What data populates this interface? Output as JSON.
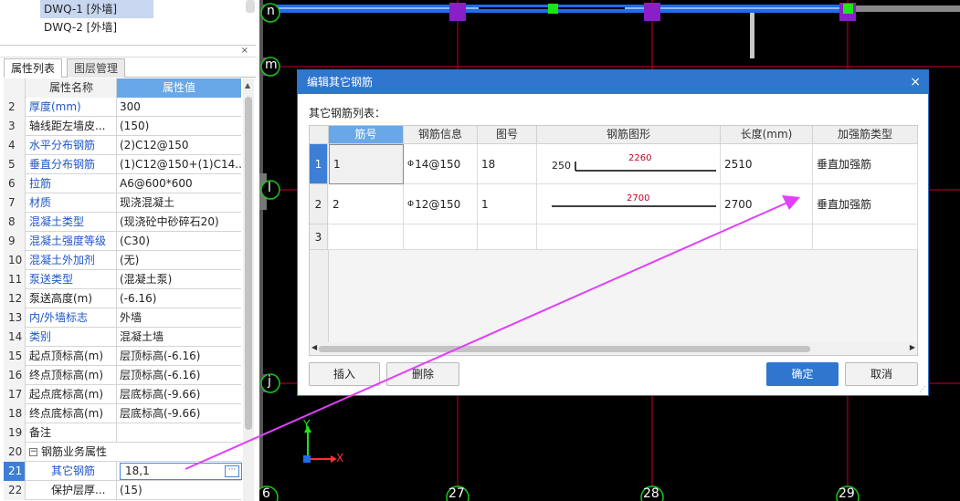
{
  "tree": {
    "items": [
      {
        "label": "DWQ-1 [外墙]",
        "selected": true
      },
      {
        "label": "DWQ-2 [外墙]",
        "selected": false
      }
    ]
  },
  "panel": {
    "close_glyph": "×"
  },
  "tabs": [
    {
      "label": "属性列表",
      "active": true
    },
    {
      "label": "图层管理",
      "active": false
    }
  ],
  "properties": {
    "header": {
      "name": "属性名称",
      "value": "属性值"
    },
    "rows": [
      {
        "num": "2",
        "name": "厚度(mm)",
        "value": "300",
        "blue": true
      },
      {
        "num": "3",
        "name": "轴线距左墙皮...",
        "value": "(150)",
        "blue": false
      },
      {
        "num": "4",
        "name": "水平分布钢筋",
        "value": "(2)C12@150",
        "blue": true
      },
      {
        "num": "5",
        "name": "垂直分布钢筋",
        "value": "(1)C12@150+(1)C14...",
        "blue": true
      },
      {
        "num": "6",
        "name": "拉筋",
        "value": "A6@600*600",
        "blue": true
      },
      {
        "num": "7",
        "name": "材质",
        "value": "现浇混凝土",
        "blue": true
      },
      {
        "num": "8",
        "name": "混凝土类型",
        "value": "(现浇砼中砂碎石20)",
        "blue": true
      },
      {
        "num": "9",
        "name": "混凝土强度等级",
        "value": "(C30)",
        "blue": true
      },
      {
        "num": "10",
        "name": "混凝土外加剂",
        "value": "(无)",
        "blue": true
      },
      {
        "num": "11",
        "name": "泵送类型",
        "value": "(混凝土泵)",
        "blue": true
      },
      {
        "num": "12",
        "name": "泵送高度(m)",
        "value": "(-6.16)",
        "blue": false
      },
      {
        "num": "13",
        "name": "内/外墙标志",
        "value": "外墙",
        "blue": true
      },
      {
        "num": "14",
        "name": "类别",
        "value": "混凝土墙",
        "blue": true
      },
      {
        "num": "15",
        "name": "起点顶标高(m)",
        "value": "层顶标高(-6.16)",
        "blue": false
      },
      {
        "num": "16",
        "name": "终点顶标高(m)",
        "value": "层顶标高(-6.16)",
        "blue": false
      },
      {
        "num": "17",
        "name": "起点底标高(m)",
        "value": "层底标高(-9.66)",
        "blue": false
      },
      {
        "num": "18",
        "name": "终点底标高(m)",
        "value": "层底标高(-9.66)",
        "blue": false
      },
      {
        "num": "19",
        "name": "备注",
        "value": "",
        "blue": false
      }
    ],
    "group_row": {
      "num": "20",
      "collapse": "−",
      "name": "钢筋业务属性"
    },
    "edit_row": {
      "num": "21",
      "name": "其它钢筋",
      "value": "18,1",
      "button": "···"
    },
    "last_row": {
      "num": "22",
      "name": "保护层厚...",
      "value": "(15)"
    }
  },
  "cad": {
    "axis_labels_top": [
      "n",
      "m",
      "l",
      "j"
    ],
    "axis_labels_bottom": [
      "6",
      "27",
      "28",
      "29"
    ],
    "ucs": {
      "y": "Y",
      "x": "X"
    }
  },
  "dialog": {
    "title": "编辑其它钢筋",
    "close_glyph": "×",
    "list_label": "其它钢筋列表：",
    "columns": [
      "筋号",
      "钢筋信息",
      "图号",
      "钢筋图形",
      "长度(mm)",
      "加强筋类型"
    ],
    "rows": [
      {
        "num": "1",
        "bar_no": "1",
        "steel_glyph": "Φ",
        "info": "14@150",
        "fig": "18",
        "shape_left": "250",
        "shape_mid": "2260",
        "length": "2510",
        "type": "垂直加强筋"
      },
      {
        "num": "2",
        "bar_no": "2",
        "steel_glyph": "Φ",
        "info": "12@150",
        "fig": "1",
        "shape_left": "",
        "shape_mid": "2700",
        "length": "2700",
        "type": "垂直加强筋"
      },
      {
        "num": "3",
        "bar_no": "",
        "steel_glyph": "",
        "info": "",
        "fig": "",
        "shape_left": "",
        "shape_mid": "",
        "length": "",
        "type": ""
      }
    ],
    "scroll_left": "◀",
    "scroll_right": "▶",
    "buttons": {
      "insert": "插入",
      "delete": "删除",
      "ok": "确定",
      "cancel": "取消"
    }
  },
  "colors": {
    "accent": "#2f76cf",
    "header_active": "#69a8e8",
    "annotation_arrow": "#e040fb",
    "grid_red": "#c8002a"
  }
}
